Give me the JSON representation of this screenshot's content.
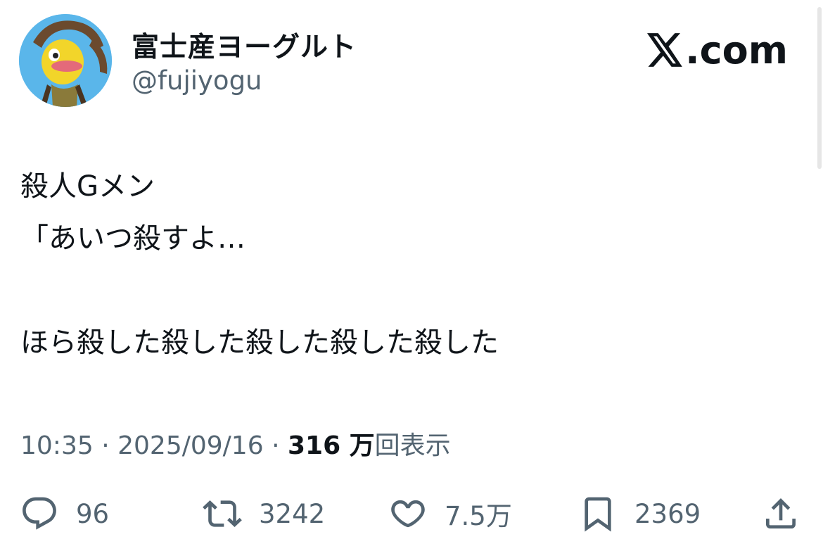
{
  "account": {
    "display_name": "富士産ヨーグルト",
    "handle": "@fujiyogu"
  },
  "brand": {
    "name": ".com",
    "icon": "x-logo-icon"
  },
  "tweet": {
    "text": "殺人Gメン\n「あいつ殺すよ…\n\nほら殺した殺した殺した殺した殺した"
  },
  "meta": {
    "time": "10:35",
    "separator": "·",
    "date": "2025/09/16",
    "views_count": "316 万",
    "views_label": "回表示"
  },
  "actions": {
    "reply": {
      "icon": "reply-bubble-icon",
      "count": "96"
    },
    "retweet": {
      "icon": "retweet-icon",
      "count": "3242"
    },
    "like": {
      "icon": "heart-icon",
      "count": "7.5万"
    },
    "bookmark": {
      "icon": "bookmark-icon",
      "count": "2369"
    },
    "share": {
      "icon": "share-icon"
    }
  },
  "colors": {
    "text": "#0f1419",
    "muted": "#536471",
    "avatar_bg": "#5ab6ea"
  }
}
